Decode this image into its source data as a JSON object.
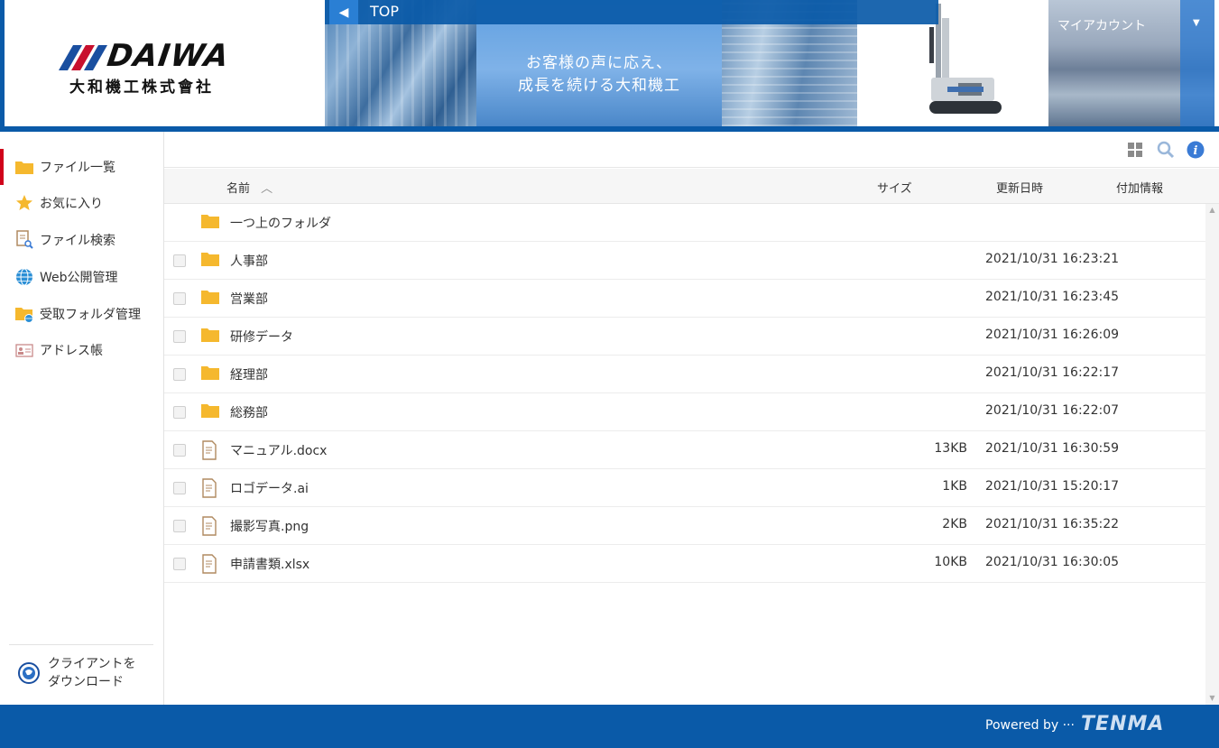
{
  "header": {
    "logo_word": "DAIWA",
    "logo_sub": "大和機工株式會社",
    "slogan_line1": "お客様の声に応え、",
    "slogan_line2": "成長を続ける大和機工",
    "top_label": "TOP",
    "account_label": "マイアカウント"
  },
  "sidebar": {
    "items": [
      {
        "label": "ファイル一覧",
        "icon": "folder-icon"
      },
      {
        "label": "お気に入り",
        "icon": "star-icon"
      },
      {
        "label": "ファイル検索",
        "icon": "file-search-icon"
      },
      {
        "label": "Web公開管理",
        "icon": "globe-icon"
      },
      {
        "label": "受取フォルダ管理",
        "icon": "folder-globe-icon"
      },
      {
        "label": "アドレス帳",
        "icon": "address-card-icon"
      }
    ],
    "download_line1": "クライアントを",
    "download_line2": "ダウンロード"
  },
  "table": {
    "col_name": "名前",
    "col_size": "サイズ",
    "col_date": "更新日時",
    "col_info": "付加情報",
    "parent_folder": "一つ上のフォルダ",
    "rows": [
      {
        "name": "人事部",
        "type": "folder",
        "size": "",
        "date": "2021/10/31 16:23:21"
      },
      {
        "name": "営業部",
        "type": "folder",
        "size": "",
        "date": "2021/10/31 16:23:45"
      },
      {
        "name": "研修データ",
        "type": "folder",
        "size": "",
        "date": "2021/10/31 16:26:09"
      },
      {
        "name": "経理部",
        "type": "folder",
        "size": "",
        "date": "2021/10/31 16:22:17"
      },
      {
        "name": "総務部",
        "type": "folder",
        "size": "",
        "date": "2021/10/31 16:22:07"
      },
      {
        "name": "マニュアル.docx",
        "type": "file",
        "size": "13KB",
        "date": "2021/10/31 16:30:59"
      },
      {
        "name": "ロゴデータ.ai",
        "type": "file",
        "size": "1KB",
        "date": "2021/10/31 15:20:17"
      },
      {
        "name": "撮影写真.png",
        "type": "file",
        "size": "2KB",
        "date": "2021/10/31 16:35:22"
      },
      {
        "name": "申請書類.xlsx",
        "type": "file",
        "size": "10KB",
        "date": "2021/10/31 16:30:05"
      }
    ]
  },
  "footer": {
    "powered": "Powered by ···",
    "brand": "TENMA"
  },
  "colors": {
    "primary": "#0a5aa8",
    "active_marker": "#d0021b",
    "folder": "#f5b82e"
  }
}
